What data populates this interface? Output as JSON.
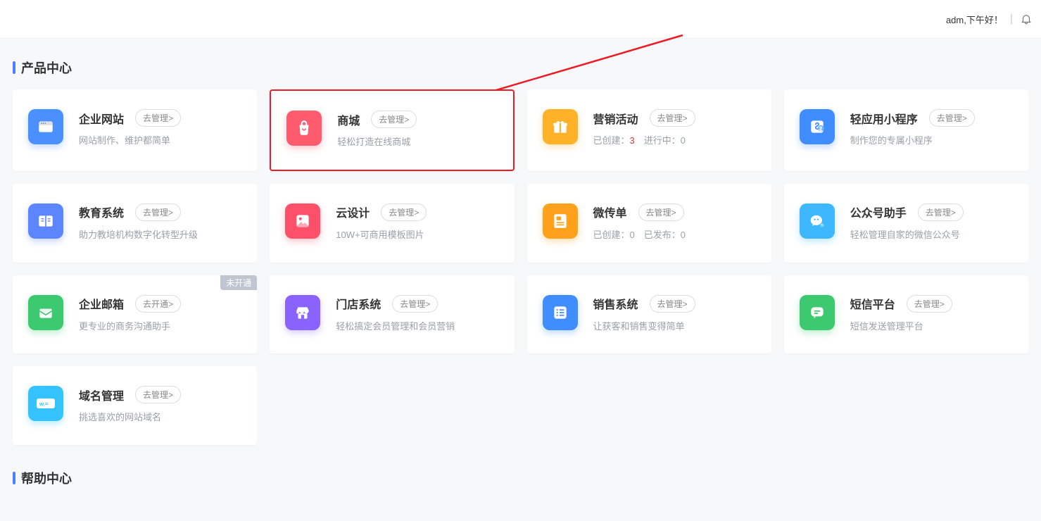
{
  "header": {
    "greeting": "adm,下午好！"
  },
  "sections": {
    "products_title": "产品中心",
    "help_title": "帮助中心"
  },
  "cards": [
    {
      "name": "enterprise-website",
      "title": "企业网站",
      "button": "去管理>",
      "desc": "网站制作、维护都简单",
      "icon_bg": "#4a90ff",
      "icon": "window"
    },
    {
      "name": "mall",
      "title": "商城",
      "button": "去管理>",
      "desc": "轻松打造在线商城",
      "icon_bg": "#ff5b6e",
      "icon": "bag",
      "highlight": true
    },
    {
      "name": "marketing",
      "title": "营销活动",
      "button": "去管理>",
      "desc_prefix": "已创建：",
      "desc_red": "3",
      "desc_suffix": "　进行中：0",
      "icon_bg": "#ffb128",
      "icon": "gift"
    },
    {
      "name": "light-app",
      "title": "轻应用小程序",
      "button": "去管理>",
      "desc": "制作您的专属小程序",
      "icon_bg": "#3f8dff",
      "icon": "miniapp"
    },
    {
      "name": "education",
      "title": "教育系统",
      "button": "去管理>",
      "desc": "助力教培机构数字化转型升级",
      "icon_bg": "#5b86ff",
      "icon": "book"
    },
    {
      "name": "cloud-design",
      "title": "云设计",
      "button": "去管理>",
      "desc": "10W+可商用模板图片",
      "icon_bg": "#ff506a",
      "icon": "image"
    },
    {
      "name": "wei-flyer",
      "title": "微传单",
      "button": "去管理>",
      "desc": "已创建：0　已发布：0",
      "icon_bg": "#ffa11a",
      "icon": "flyer"
    },
    {
      "name": "wechat-assistant",
      "title": "公众号助手",
      "button": "去管理>",
      "desc": "轻松管理自家的微信公众号",
      "icon_bg": "#3db8ff",
      "icon": "wechat"
    },
    {
      "name": "enterprise-mail",
      "title": "企业邮箱",
      "button": "去开通>",
      "desc": "更专业的商务沟通助手",
      "icon_bg": "#3cc96f",
      "icon": "mail",
      "badge": "未开通"
    },
    {
      "name": "store-system",
      "title": "门店系统",
      "button": "去管理>",
      "desc": "轻松搞定会员管理和会员营销",
      "icon_bg": "#8a63ff",
      "icon": "store"
    },
    {
      "name": "sales-system",
      "title": "销售系统",
      "button": "去管理>",
      "desc": "让获客和销售变得简单",
      "icon_bg": "#3f8dff",
      "icon": "list"
    },
    {
      "name": "sms-platform",
      "title": "短信平台",
      "button": "去管理>",
      "desc": "短信发送管理平台",
      "icon_bg": "#3cc96f",
      "icon": "message"
    },
    {
      "name": "domain",
      "title": "域名管理",
      "button": "去管理>",
      "desc": "挑选喜欢的网站域名",
      "icon_bg": "#35c3ff",
      "icon": "domain"
    }
  ]
}
